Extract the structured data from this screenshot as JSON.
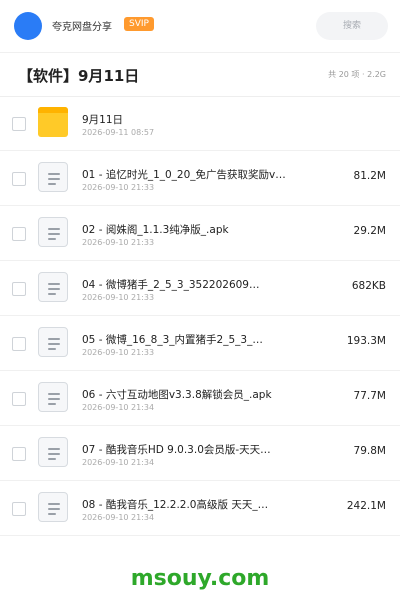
{
  "header": {
    "app_name": "夸克网盘分享",
    "badge": "SVIP",
    "search_label": "搜索",
    "colors": {
      "avatar": "#2a7cf6",
      "badge": "#ff9a2e"
    }
  },
  "folder": {
    "title": "【软件】9月11日",
    "meta": "共 20 项 · 2.2G"
  },
  "items": [
    {
      "type": "folder",
      "icon": "folder-icon",
      "name": "9月11日",
      "date": "2026-09-11 08:57",
      "size": ""
    },
    {
      "type": "file",
      "icon": "file-icon",
      "name": "01 - 追忆时光_1_0_20_免广告获取奖励v…",
      "date": "2026-09-10 21:33",
      "size": "81.2M"
    },
    {
      "type": "file",
      "icon": "file-icon",
      "name": "02 - 阅姝阁_1.1.3纯净版_.apk",
      "date": "2026-09-10 21:33",
      "size": "29.2M"
    },
    {
      "type": "file",
      "icon": "file-icon",
      "name": "04 - 微博猪手_2_5_3_352202609…",
      "date": "2026-09-10 21:33",
      "size": "682KB"
    },
    {
      "type": "file",
      "icon": "file-icon",
      "name": "05 - 微博_16_8_3_内置猪手2_5_3_…",
      "date": "2026-09-10 21:33",
      "size": "193.3M"
    },
    {
      "type": "file",
      "icon": "file-icon",
      "name": "06 - 六寸互动地图v3.3.8解锁会员_.apk",
      "date": "2026-09-10 21:34",
      "size": "77.7M"
    },
    {
      "type": "file",
      "icon": "file-icon",
      "name": "07 - 酷我音乐HD 9.0.3.0会员版-天天…",
      "date": "2026-09-10 21:34",
      "size": "79.8M"
    },
    {
      "type": "file",
      "icon": "file-icon",
      "name": "08 - 酷我音乐_12.2.2.0高级版 天天_…",
      "date": "2026-09-10 21:34",
      "size": "242.1M"
    }
  ],
  "watermark": {
    "text": "msouy.com",
    "color": "#2ea82a"
  }
}
